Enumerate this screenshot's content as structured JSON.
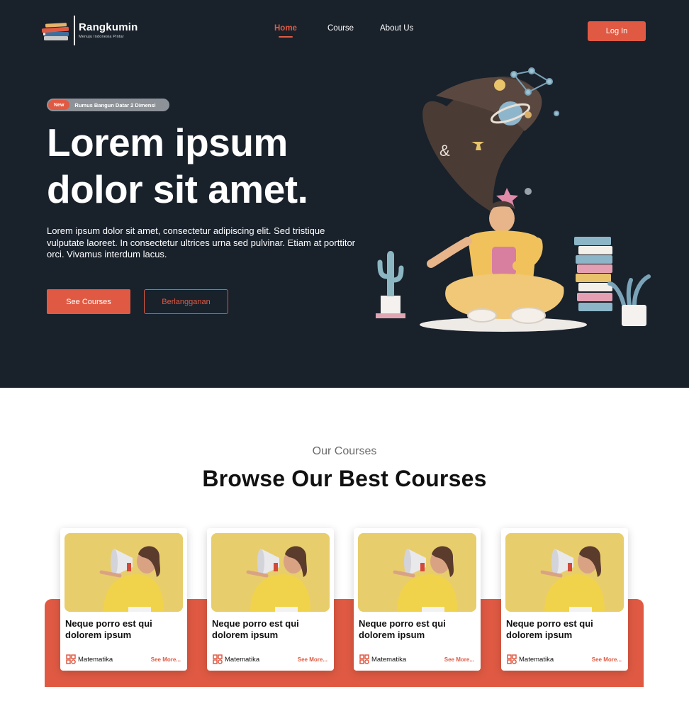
{
  "brand": {
    "name": "Rangkumin",
    "tagline": "Menuju Indonesia Pintar",
    "accent": "#e05a43",
    "dark_bg": "#19212b"
  },
  "nav": {
    "items": [
      {
        "label": "Home",
        "active": true
      },
      {
        "label": "Course",
        "active": false
      },
      {
        "label": "About Us",
        "active": false
      }
    ],
    "login_label": "Log In"
  },
  "hero": {
    "badge_new": "New",
    "badge_text": "Rumus Bangun Datar 2 Dimensi",
    "title_line1": "Lorem ipsum",
    "title_line2": "dolor sit amet.",
    "description": "Lorem ipsum dolor sit amet, consectetur adipiscing elit. Sed tristique vulputate laoreet. In consectetur ultrices urna sed pulvinar. Etiam at porttitor orci. Vivamus interdum lacus.",
    "primary_cta": "See Courses",
    "secondary_cta": "Berlangganan",
    "illustration_icon": "student-thinking-illustration"
  },
  "courses": {
    "eyebrow": "Our Courses",
    "title": "Browse Our Best Courses",
    "cards": [
      {
        "title": "Neque porro est qui dolorem ipsum",
        "category": "Matematika",
        "more": "See More..."
      },
      {
        "title": "Neque porro est qui dolorem ipsum",
        "category": "Matematika",
        "more": "See More..."
      },
      {
        "title": "Neque porro est qui dolorem ipsum",
        "category": "Matematika",
        "more": "See More..."
      },
      {
        "title": "Neque porro est qui dolorem ipsum",
        "category": "Matematika",
        "more": "See More..."
      }
    ]
  }
}
